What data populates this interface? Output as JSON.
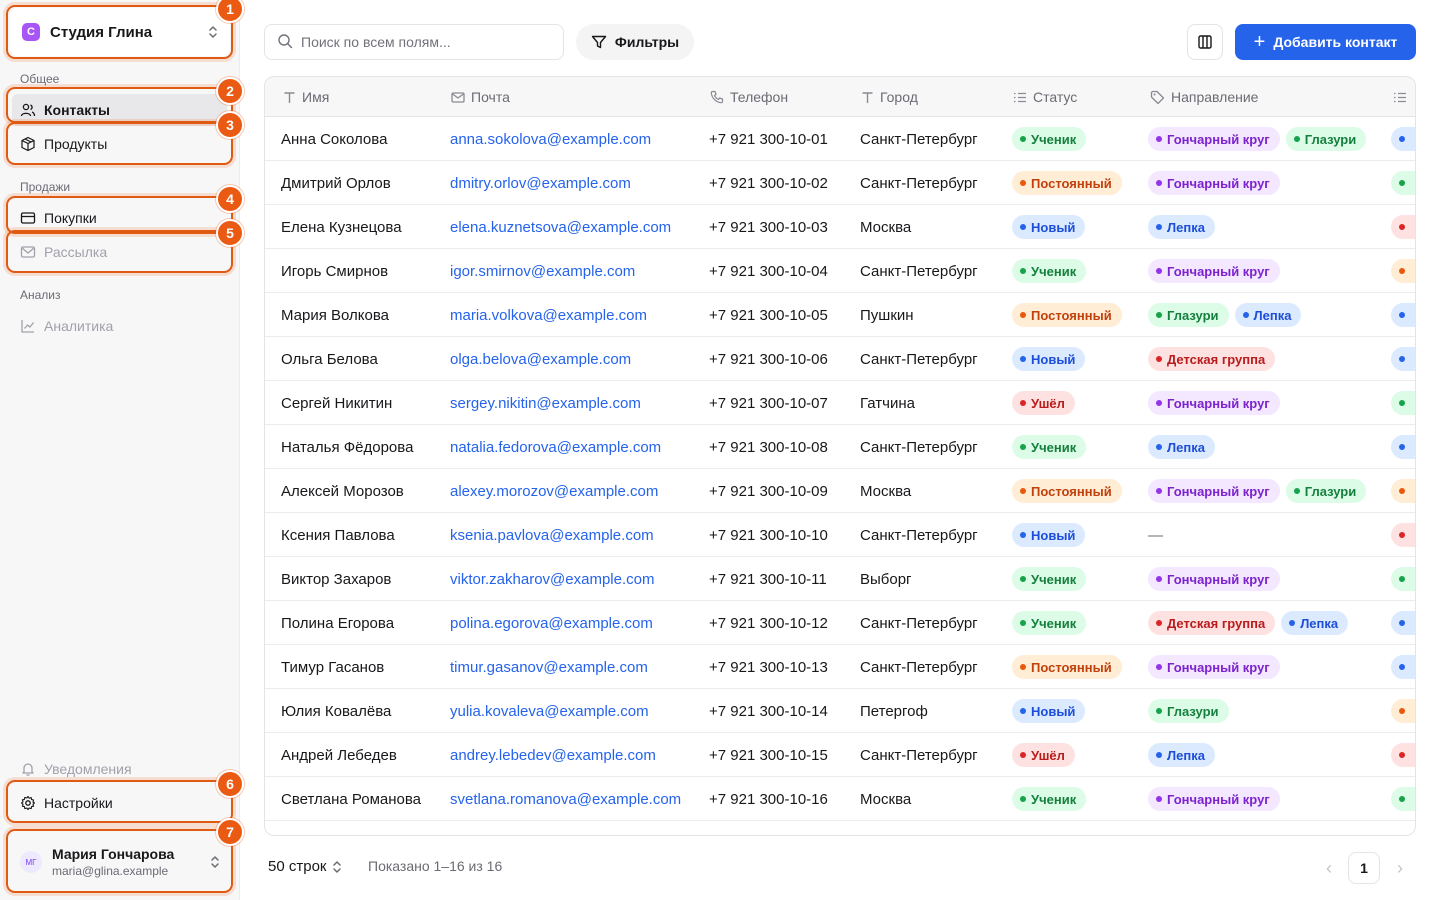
{
  "colors": {
    "accent": "#2563eb",
    "annotation": "#ea5a12",
    "workspace_logo": "#a855f7"
  },
  "sidebar": {
    "workspace": {
      "logo_letter": "С",
      "name": "Студия Глина"
    },
    "sections": [
      "Общее",
      "Продажи",
      "Анализ"
    ],
    "items": [
      {
        "label": "Контакты",
        "icon": "users-icon"
      },
      {
        "label": "Продукты",
        "icon": "box-icon"
      },
      {
        "label": "Покупки",
        "icon": "card-icon"
      },
      {
        "label": "Рассылка",
        "icon": "mail-icon"
      },
      {
        "label": "Аналитика",
        "icon": "chart-icon"
      }
    ],
    "notifications": "Уведомления",
    "settings": "Настройки",
    "user": {
      "initials": "МГ",
      "name": "Мария Гончарова",
      "email": "maria@glina.example"
    }
  },
  "annotations": [
    "1",
    "2",
    "3",
    "4",
    "5",
    "6",
    "7"
  ],
  "toolbar": {
    "search_placeholder": "Поиск по всем полям...",
    "filters": "Фильтры",
    "add_contact": "Добавить контакт"
  },
  "table": {
    "columns": [
      "Имя",
      "Почта",
      "Телефон",
      "Город",
      "Статус",
      "Направление"
    ],
    "rows": [
      {
        "name": "Анна Соколова",
        "email": "anna.sokolova@example.com",
        "phone": "+7 921 300-10-01",
        "city": "Санкт-Петербург",
        "status": "Ученик",
        "tags": [
          "Гончарный круг",
          "Глазури"
        ],
        "extra": "blue"
      },
      {
        "name": "Дмитрий Орлов",
        "email": "dmitry.orlov@example.com",
        "phone": "+7 921 300-10-02",
        "city": "Санкт-Петербург",
        "status": "Постоянный",
        "tags": [
          "Гончарный круг"
        ],
        "extra": "green"
      },
      {
        "name": "Елена Кузнецова",
        "email": "elena.kuznetsova@example.com",
        "phone": "+7 921 300-10-03",
        "city": "Москва",
        "status": "Новый",
        "tags": [
          "Лепка"
        ],
        "extra": "red"
      },
      {
        "name": "Игорь Смирнов",
        "email": "igor.smirnov@example.com",
        "phone": "+7 921 300-10-04",
        "city": "Санкт-Петербург",
        "status": "Ученик",
        "tags": [
          "Гончарный круг"
        ],
        "extra": "orange"
      },
      {
        "name": "Мария Волкова",
        "email": "maria.volkova@example.com",
        "phone": "+7 921 300-10-05",
        "city": "Пушкин",
        "status": "Постоянный",
        "tags": [
          "Глазури",
          "Лепка"
        ],
        "extra": "blue"
      },
      {
        "name": "Ольга Белова",
        "email": "olga.belova@example.com",
        "phone": "+7 921 300-10-06",
        "city": "Санкт-Петербург",
        "status": "Новый",
        "tags": [
          "Детская группа"
        ],
        "extra": "blue"
      },
      {
        "name": "Сергей Никитин",
        "email": "sergey.nikitin@example.com",
        "phone": "+7 921 300-10-07",
        "city": "Гатчина",
        "status": "Ушёл",
        "tags": [
          "Гончарный круг"
        ],
        "extra": "green"
      },
      {
        "name": "Наталья Фёдорова",
        "email": "natalia.fedorova@example.com",
        "phone": "+7 921 300-10-08",
        "city": "Санкт-Петербург",
        "status": "Ученик",
        "tags": [
          "Лепка"
        ],
        "extra": "blue"
      },
      {
        "name": "Алексей Морозов",
        "email": "alexey.morozov@example.com",
        "phone": "+7 921 300-10-09",
        "city": "Москва",
        "status": "Постоянный",
        "tags": [
          "Гончарный круг",
          "Глазури"
        ],
        "extra": "orange"
      },
      {
        "name": "Ксения Павлова",
        "email": "ksenia.pavlova@example.com",
        "phone": "+7 921 300-10-10",
        "city": "Санкт-Петербург",
        "status": "Новый",
        "tags": [],
        "extra": "red"
      },
      {
        "name": "Виктор Захаров",
        "email": "viktor.zakharov@example.com",
        "phone": "+7 921 300-10-11",
        "city": "Выборг",
        "status": "Ученик",
        "tags": [
          "Гончарный круг"
        ],
        "extra": "green"
      },
      {
        "name": "Полина Егорова",
        "email": "polina.egorova@example.com",
        "phone": "+7 921 300-10-12",
        "city": "Санкт-Петербург",
        "status": "Ученик",
        "tags": [
          "Детская группа",
          "Лепка"
        ],
        "extra": "blue"
      },
      {
        "name": "Тимур Гасанов",
        "email": "timur.gasanov@example.com",
        "phone": "+7 921 300-10-13",
        "city": "Санкт-Петербург",
        "status": "Постоянный",
        "tags": [
          "Гончарный круг"
        ],
        "extra": "blue"
      },
      {
        "name": "Юлия Ковалёва",
        "email": "yulia.kovaleva@example.com",
        "phone": "+7 921 300-10-14",
        "city": "Петергоф",
        "status": "Новый",
        "tags": [
          "Глазури"
        ],
        "extra": "orange"
      },
      {
        "name": "Андрей Лебедев",
        "email": "andrey.lebedev@example.com",
        "phone": "+7 921 300-10-15",
        "city": "Санкт-Петербург",
        "status": "Ушёл",
        "tags": [
          "Лепка"
        ],
        "extra": "red"
      },
      {
        "name": "Светлана Романова",
        "email": "svetlana.romanova@example.com",
        "phone": "+7 921 300-10-16",
        "city": "Москва",
        "status": "Ученик",
        "tags": [
          "Гончарный круг"
        ],
        "extra": "green"
      }
    ],
    "empty_tag": "—"
  },
  "status_styles": {
    "Ученик": {
      "bg": "#dcfce7",
      "fg": "#15803d",
      "dot": "#16a34a"
    },
    "Постоянный": {
      "bg": "#ffedd5",
      "fg": "#c2410c",
      "dot": "#ea580c"
    },
    "Новый": {
      "bg": "#dbeafe",
      "fg": "#1d4ed8",
      "dot": "#2563eb"
    },
    "Ушёл": {
      "bg": "#fee2e2",
      "fg": "#b91c1c",
      "dot": "#dc2626"
    }
  },
  "tag_styles": {
    "Гончарный круг": {
      "bg": "#f3e8ff",
      "fg": "#7e22ce",
      "dot": "#9333ea"
    },
    "Глазури": {
      "bg": "#dcfce7",
      "fg": "#15803d",
      "dot": "#16a34a"
    },
    "Лепка": {
      "bg": "#dbeafe",
      "fg": "#1d4ed8",
      "dot": "#2563eb"
    },
    "Детская группа": {
      "bg": "#fee2e2",
      "fg": "#b91c1c",
      "dot": "#dc2626"
    }
  },
  "extra_styles": {
    "blue": {
      "bg": "#dbeafe",
      "dot": "#2563eb"
    },
    "green": {
      "bg": "#dcfce7",
      "dot": "#16a34a"
    },
    "red": {
      "bg": "#fee2e2",
      "dot": "#dc2626"
    },
    "orange": {
      "bg": "#ffedd5",
      "dot": "#ea580c"
    }
  },
  "footer": {
    "rows_per_page": "50 строк",
    "shown": "Показано 1–16 из 16",
    "current_page": "1"
  }
}
